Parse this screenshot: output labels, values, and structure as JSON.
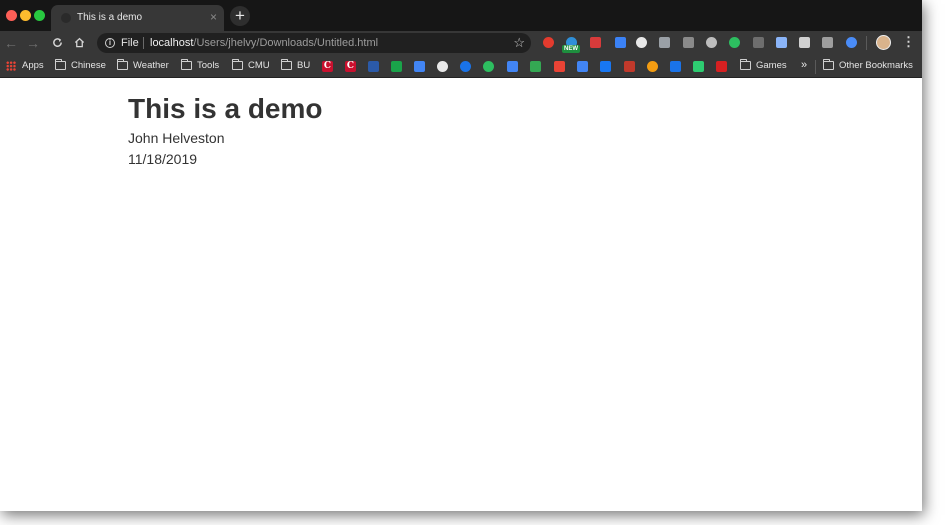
{
  "window": {
    "tab_title": "This is a demo",
    "tab_close": "×",
    "new_tab": "+"
  },
  "toolbar": {
    "back": "←",
    "forward": "→",
    "reload": "C",
    "address": {
      "scheme_label": "File",
      "host": "localhost",
      "path": "/Users/jhelvy/Downloads/Untitled.html"
    },
    "bookmark_star": "☆",
    "new_badge": "NEW",
    "menu": "⋮",
    "extensions": [
      {
        "name": "opera-extension-icon",
        "color": "#e33b2e"
      },
      {
        "name": "cloud-extension-icon",
        "color": "#2f8fd8"
      },
      {
        "name": "bug-extension-icon",
        "color": "#d83b3b"
      },
      {
        "name": "pen-extension-icon",
        "color": "#3b82f6"
      },
      {
        "name": "chat-extension-icon",
        "color": "#e8e8e8"
      },
      {
        "name": "key-extension-icon",
        "color": "#9aa0a6"
      },
      {
        "name": "a-extension-icon",
        "color": "#8a8a8a"
      },
      {
        "name": "circle-extension-icon",
        "color": "#bdbdbd"
      },
      {
        "name": "evernote-extension-icon",
        "color": "#2dbe60"
      },
      {
        "name": "g-extension-icon",
        "color": "#6e6e6e"
      },
      {
        "name": "diamond-extension-icon",
        "color": "#8ab4f8"
      },
      {
        "name": "page-extension-icon",
        "color": "#d0d0d0"
      },
      {
        "name": "window-extension-icon",
        "color": "#9e9e9e"
      },
      {
        "name": "zoom-extension-icon",
        "color": "#4a8cf7"
      }
    ]
  },
  "bookmarks": {
    "apps": "Apps",
    "folders": {
      "chinese": "Chinese",
      "weather": "Weather",
      "tools": "Tools",
      "cmu": "CMU",
      "bu": "BU",
      "games": "Games",
      "other": "Other Bookmarks"
    },
    "overflow": "»",
    "icons": [
      {
        "name": "c-red-bookmark-icon",
        "color": "#c8102e",
        "letter": "C"
      },
      {
        "name": "c-red2-bookmark-icon",
        "color": "#c8102e",
        "letter": "C"
      },
      {
        "name": "library-bookmark-icon",
        "color": "#2b5aa8"
      },
      {
        "name": "doc-green-bookmark-icon",
        "color": "#1aa34a"
      },
      {
        "name": "translate-bookmark-icon",
        "color": "#4285f4"
      },
      {
        "name": "globe-bookmark-icon",
        "color": "#e8e8e8"
      },
      {
        "name": "chat-blue-bookmark-icon",
        "color": "#1a73e8"
      },
      {
        "name": "evernote-bookmark-icon",
        "color": "#2dbe60"
      },
      {
        "name": "docs-bookmark-icon",
        "color": "#4285f4"
      },
      {
        "name": "maps-bookmark-icon",
        "color": "#34a853"
      },
      {
        "name": "gmail-bookmark-icon",
        "color": "#ea4335"
      },
      {
        "name": "calendar-bookmark-icon",
        "color": "#4285f4"
      },
      {
        "name": "facebook-bookmark-icon",
        "color": "#1877f2"
      },
      {
        "name": "bird-bookmark-icon",
        "color": "#c0392b"
      },
      {
        "name": "play-orange-bookmark-icon",
        "color": "#f39c12"
      },
      {
        "name": "expand-bookmark-icon",
        "color": "#1a73e8"
      },
      {
        "name": "w-green-bookmark-icon",
        "color": "#2ecc71"
      },
      {
        "name": "npr-bookmark-icon",
        "color": "#d62021"
      }
    ]
  },
  "page": {
    "title": "This is a demo",
    "author": "John Helveston",
    "date": "11/18/2019"
  }
}
